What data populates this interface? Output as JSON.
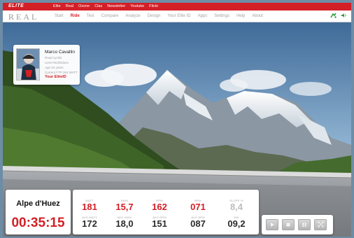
{
  "topbar": {
    "brand": "ELITE",
    "links": [
      "Elite",
      "Real",
      "Ozone",
      "Clas",
      "Newsletter",
      "Youtube",
      "Flickr"
    ]
  },
  "navbar": {
    "logo": "REAL",
    "items": [
      "Start",
      "Ride",
      "Test",
      "Compare",
      "Analyze",
      "Design",
      "Your Elite ID",
      "Apps",
      "Settings",
      "Help",
      "About"
    ],
    "active": "Ride",
    "icons": [
      "bicycle-icon",
      "volume-icon"
    ]
  },
  "profile": {
    "name": "Marco Cavallin",
    "info": [
      "Road cyclist",
      "Level Worldclass",
      "Age 34 years",
      "Current FTP 264 WATT"
    ],
    "link": "Your EliteID"
  },
  "route": {
    "name": "Alpe d'Huez",
    "time": "00:35:15"
  },
  "stats": {
    "row1": [
      {
        "label": "WATT",
        "value": "181",
        "style": "red"
      },
      {
        "label": "KM/H",
        "value": "15,7",
        "style": "red"
      },
      {
        "label": "RPM",
        "value": "162",
        "style": "red"
      },
      {
        "label": "BPM",
        "value": "071",
        "style": "red"
      },
      {
        "label": "SLOPE %",
        "value": "8,4",
        "style": "faded"
      }
    ],
    "row2": [
      {
        "label": "AVG WATT",
        "value": "172",
        "style": "dark"
      },
      {
        "label": "AVG KM/H",
        "value": "18,0",
        "style": "dark"
      },
      {
        "label": "AVG RPM",
        "value": "151",
        "style": "dark"
      },
      {
        "label": "AVG BPM",
        "value": "087",
        "style": "dark"
      },
      {
        "label": "KM",
        "value": "09,2",
        "style": "dark"
      }
    ]
  },
  "controls": [
    "play-icon",
    "stop-icon",
    "pause-icon",
    "fullscreen-icon"
  ],
  "colors": {
    "accent": "#d31f26",
    "icon_green": "#2f9c3f"
  }
}
